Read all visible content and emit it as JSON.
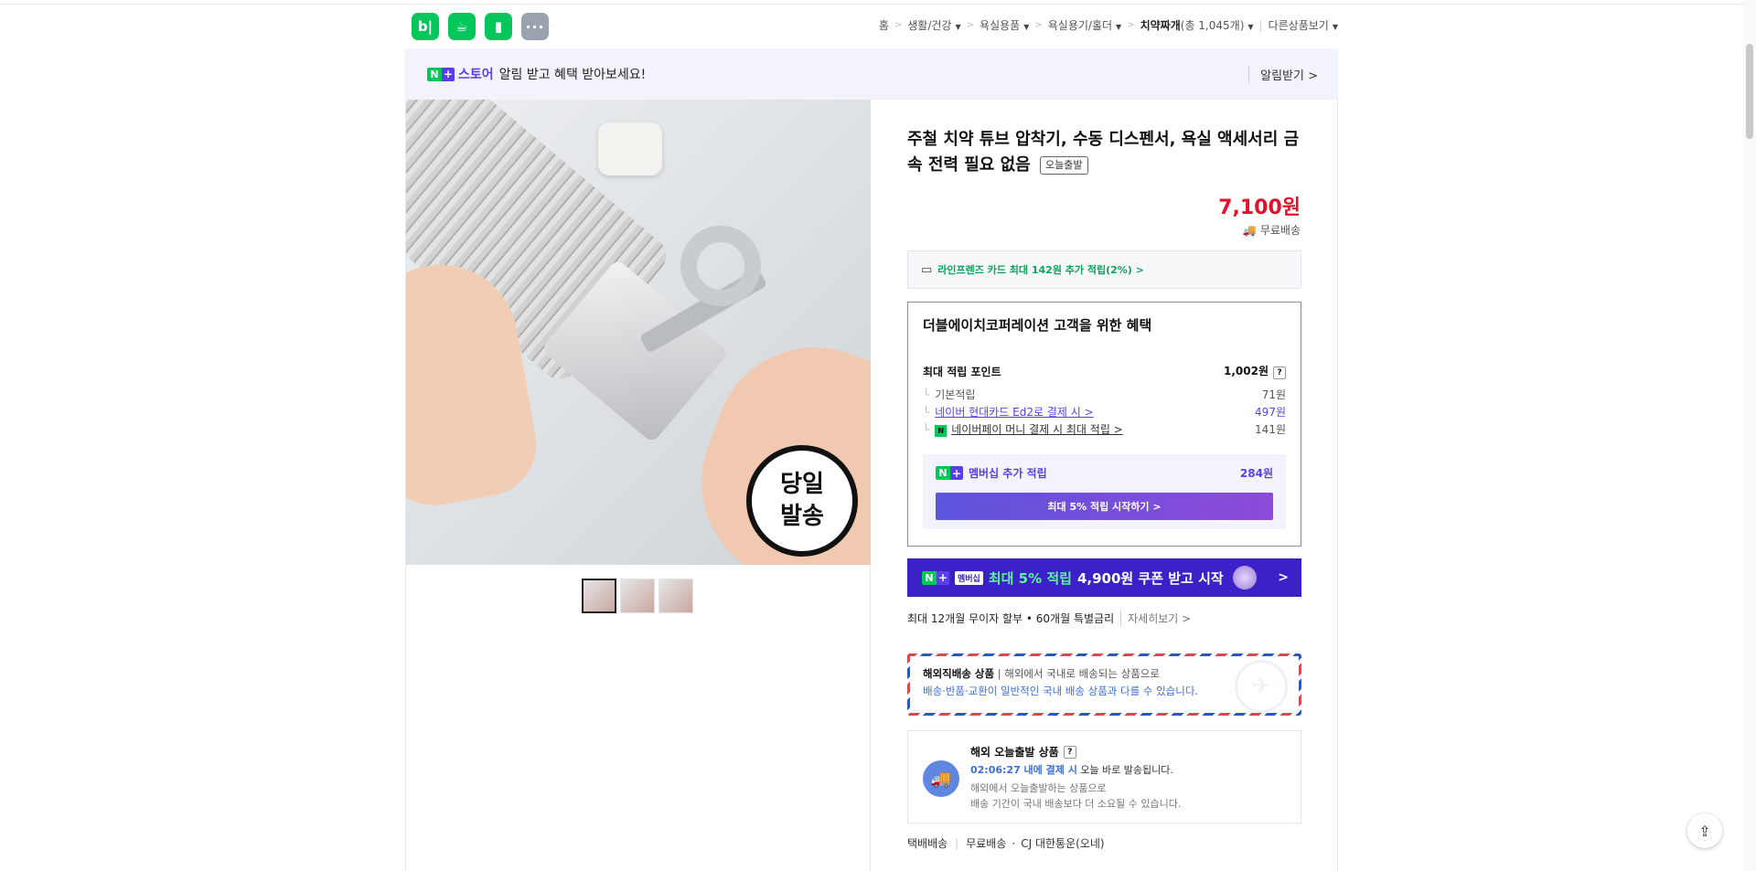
{
  "header": {
    "apps": [
      {
        "label": "b|",
        "icon": "blog-icon"
      },
      {
        "label": "☕",
        "icon": "cafe-icon"
      },
      {
        "label": "▮",
        "icon": "bookmark-icon"
      },
      {
        "label": "···",
        "icon": "more-icon"
      }
    ],
    "breadcrumb": [
      {
        "label": "홈",
        "caret": false
      },
      {
        "label": "생활/건강",
        "caret": true
      },
      {
        "label": "욕실용품",
        "caret": true
      },
      {
        "label": "욕실용기/홀더",
        "caret": true
      },
      {
        "label": "치약짜개",
        "count": "(총 1,045개)",
        "caret": true,
        "current": true
      }
    ],
    "other": "다른상품보기"
  },
  "banner": {
    "n": "N",
    "plus": "+",
    "store": "스토어",
    "message": "알림 받고 혜택 받아보세요!",
    "alarm": "알림받기 >"
  },
  "gallery": {
    "stamp_line1": "당일",
    "stamp_line2": "발송",
    "thumbnails": 3
  },
  "product": {
    "title": "주철 치약 튜브 압착기, 수동 디스펜서, 욕실 액세서리 금속 전력 필요 없음",
    "tag": "오늘출발",
    "price": "7,100원",
    "shipping": "무료배송",
    "card_offer": "라인프렌즈 카드 최대 142원 추가 적립(2%) >"
  },
  "benefit": {
    "title": "더블에이치코퍼레이션 고객을 위한 혜택",
    "max_label": "최대 적립 포인트",
    "max_value": "1,002원",
    "rows": [
      {
        "label": "기본적립",
        "value": "71원"
      },
      {
        "label": "네이버 현대카드 Ed2로 결제 시 >",
        "value": "497원"
      },
      {
        "label": "네이버페이 머니 결제 시 최대 적립 >",
        "value": "141원"
      }
    ],
    "membership_label": "멤버십 추가 적립",
    "membership_value": "284원",
    "membership_button": "최대 5% 적립 시작하기 >"
  },
  "promo": {
    "membership_tag": "멤버십",
    "highlight": "최대 5% 적립",
    "rest": "4,900원 쿠폰 받고 시작"
  },
  "installment": {
    "text": "최대 12개월 무이자 할부 • 60개월 특별금리",
    "more": "자세히보기 >"
  },
  "overseas": {
    "title": "해외직배송 상품",
    "line1": "해외에서 국내로 배송되는 상품으로",
    "line2": "배송·반품·교환이 일반적인 국내 배송 상품과 다를 수 있습니다."
  },
  "today_ship": {
    "title": "해외 오늘출발 상품",
    "time": "02:06:27 내에 결제 시",
    "time_rest": "오늘 바로 발송됩니다.",
    "note1": "해외에서 오늘출발하는 상품으로",
    "note2": "배송 기간이 국내 배송보다 더 소요될 수 있습니다."
  },
  "delivery": {
    "method": "택배배송",
    "fee": "무료배송",
    "carrier": "CJ 대한통운(오네)"
  },
  "colors": {
    "naver_green": "#03c75a",
    "plus_purple": "#5b3ee8",
    "price_red": "#e1112b"
  }
}
